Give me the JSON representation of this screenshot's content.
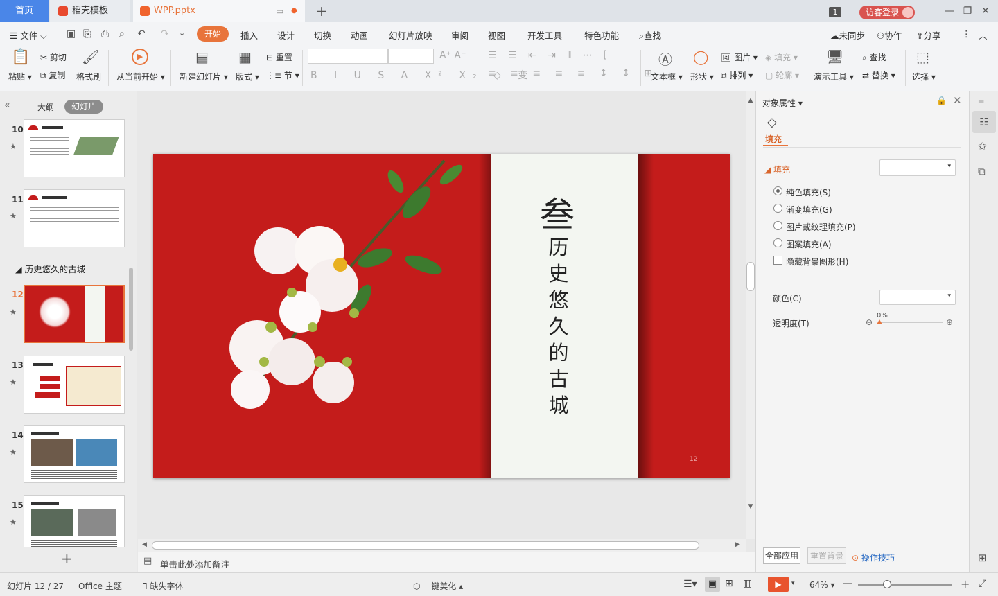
{
  "tabs": {
    "home": "首页",
    "template": "稻壳模板",
    "document": "WPP.pptx",
    "plus": "+"
  },
  "titlebar": {
    "badge": "1",
    "visitor_login": "访客登录"
  },
  "menu": {
    "file": "文件",
    "items": [
      "开始",
      "插入",
      "设计",
      "切换",
      "动画",
      "幻灯片放映",
      "审阅",
      "视图",
      "开发工具",
      "特色功能"
    ],
    "search": "查找",
    "unsynced": "未同步",
    "collab": "协作",
    "share": "分享"
  },
  "ribbon": {
    "paste": "粘贴",
    "cut": "剪切",
    "copy": "复制",
    "format_painter": "格式刷",
    "from_current": "从当前开始",
    "new_slide": "新建幻灯片",
    "layout": "版式",
    "reset": "重置",
    "section": "节",
    "textbox": "文本框",
    "shape": "形状",
    "picture": "图片",
    "arrange": "排列",
    "fill": "填充",
    "outline": "轮廓",
    "present_tool": "演示工具",
    "find": "查找",
    "replace": "替换",
    "select": "选择"
  },
  "left": {
    "outline_tab": "大纲",
    "slides_tab": "幻灯片",
    "section_title": "历史悠久的古城",
    "slides": [
      {
        "num": "10"
      },
      {
        "num": "11"
      },
      {
        "num": "12"
      },
      {
        "num": "13"
      },
      {
        "num": "14"
      },
      {
        "num": "15"
      }
    ],
    "add": "+"
  },
  "slide": {
    "numeral": "叁",
    "title_chars": [
      "历",
      "史",
      "悠",
      "久",
      "的",
      "古",
      "城"
    ],
    "page_number": "12"
  },
  "notes": {
    "placeholder": "单击此处添加备注"
  },
  "props": {
    "title": "对象属性",
    "tab_fill": "填充",
    "section_fill": "填充",
    "options": [
      "纯色填充(S)",
      "渐变填充(G)",
      "图片或纹理填充(P)",
      "图案填充(A)"
    ],
    "hide_bg": "隐藏背景图形(H)",
    "color_label": "颜色(C)",
    "transparency_label": "透明度(T)",
    "transparency_value": "0%",
    "apply_all": "全部应用",
    "reset_bg": "重置背景",
    "tips": "操作技巧"
  },
  "status": {
    "slide_counter": "幻灯片 12 / 27",
    "theme": "Office 主题",
    "missing_font": "缺失字体",
    "beautify": "一键美化",
    "zoom": "64%"
  }
}
